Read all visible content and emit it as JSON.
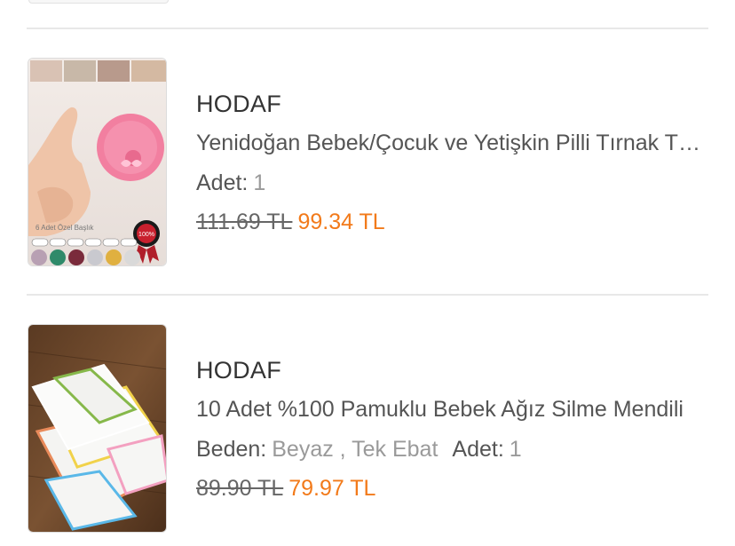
{
  "items": [
    {
      "brand": "HODAF",
      "title": "Yenidoğan Bebek/Çocuk ve Yetişkin Pilli Tırnak Törpüsü",
      "qty_label": "Adet:",
      "qty_value": "1",
      "old_price": "111.69 TL",
      "new_price": "99.34 TL",
      "image_caption": "6 Adet Özel Başlık",
      "seal_text": "100%",
      "colors": [
        "#b8a0b3",
        "#2f8a6a",
        "#7a2b3b",
        "#c9c9cf",
        "#e0b040",
        "#d9d9d9"
      ]
    },
    {
      "brand": "HODAF",
      "title": "10 Adet %100 Pamuklu Bebek Ağız Silme Mendili",
      "size_label": "Beden:",
      "size_value": "Beyaz , Tek Ebat",
      "qty_label": "Adet:",
      "qty_value": "1",
      "old_price": "89.90 TL",
      "new_price": "79.97 TL"
    }
  ],
  "colors": {
    "accent_price": "#f27a1a",
    "divider": "#e8e8e8"
  }
}
